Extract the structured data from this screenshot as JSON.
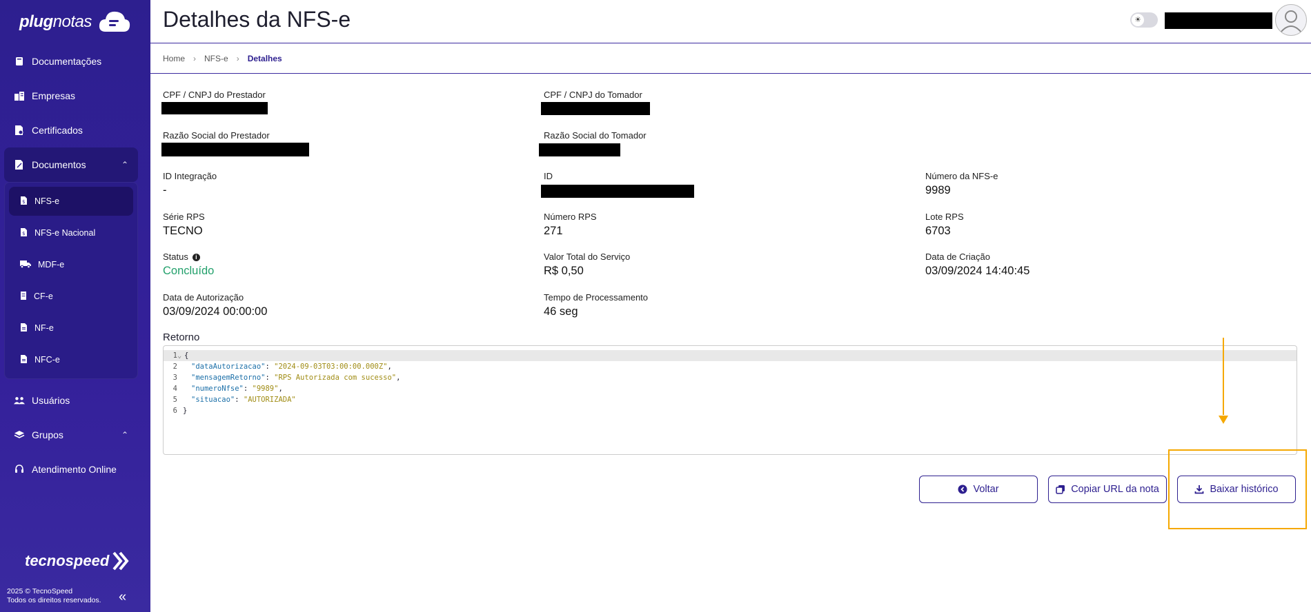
{
  "brand": {
    "name_bold": "plug",
    "name_light": "notas",
    "footer_brand": "tecnospeed"
  },
  "sidebar": {
    "items": [
      {
        "label": "Documentações",
        "icon": "book-icon"
      },
      {
        "label": "Empresas",
        "icon": "building-icon"
      },
      {
        "label": "Certificados",
        "icon": "certificate-icon"
      },
      {
        "label": "Documentos",
        "icon": "document-icon"
      }
    ],
    "sub_items": [
      {
        "label": "NFS-e",
        "icon": "file-icon",
        "active": true
      },
      {
        "label": "NFS-e Nacional",
        "icon": "file-icon"
      },
      {
        "label": "MDF-e",
        "icon": "truck-icon"
      },
      {
        "label": "CF-e",
        "icon": "receipt-icon"
      },
      {
        "label": "NF-e",
        "icon": "file-icon"
      },
      {
        "label": "NFC-e",
        "icon": "file-icon"
      }
    ],
    "items_after": [
      {
        "label": "Usuários",
        "icon": "users-icon"
      },
      {
        "label": "Grupos",
        "icon": "layers-icon"
      },
      {
        "label": "Atendimento Online",
        "icon": "headset-icon"
      }
    ],
    "copyright_line1": "2025 © TecnoSpeed",
    "copyright_line2": "Todos os direitos reservados."
  },
  "header": {
    "title": "Detalhes da NFS-e"
  },
  "breadcrumb": {
    "home": "Home",
    "section": "NFS-e",
    "current": "Detalhes"
  },
  "details": {
    "cpf_prestador_label": "CPF / CNPJ do Prestador",
    "cpf_tomador_label": "CPF / CNPJ do Tomador",
    "razao_prestador_label": "Razão Social do Prestador",
    "razao_tomador_label": "Razão Social do Tomador",
    "id_integracao_label": "ID Integração",
    "id_integracao_value": "-",
    "id_label": "ID",
    "numero_nfse_label": "Número da NFS-e",
    "numero_nfse_value": "9989",
    "serie_rps_label": "Série RPS",
    "serie_rps_value": "TECNO",
    "numero_rps_label": "Número RPS",
    "numero_rps_value": "271",
    "lote_rps_label": "Lote RPS",
    "lote_rps_value": "6703",
    "status_label": "Status",
    "status_value": "Concluído",
    "valor_label": "Valor Total do Serviço",
    "valor_value": "R$ 0,50",
    "data_criacao_label": "Data de Criação",
    "data_criacao_value": "03/09/2024 14:40:45",
    "data_autorizacao_label": "Data de Autorização",
    "data_autorizacao_value": "03/09/2024 00:00:00",
    "tempo_label": "Tempo de Processamento",
    "tempo_value": "46 seg"
  },
  "retorno": {
    "label": "Retorno",
    "lines": [
      {
        "n": "1",
        "text": "{"
      },
      {
        "n": "2",
        "key": "\"dataAutorizacao\"",
        "value": "\"2024-09-03T03:00:00.000Z\"",
        "trail": ","
      },
      {
        "n": "3",
        "key": "\"mensagemRetorno\"",
        "value": "\"RPS Autorizada com sucesso\"",
        "trail": ","
      },
      {
        "n": "4",
        "key": "\"numeroNfse\"",
        "value": "\"9989\"",
        "trail": ","
      },
      {
        "n": "5",
        "key": "\"situacao\"",
        "value": "\"AUTORIZADA\"",
        "trail": ""
      },
      {
        "n": "6",
        "text": "}"
      }
    ]
  },
  "actions": {
    "voltar": "Voltar",
    "copiar": "Copiar URL da nota",
    "baixar": "Baixar histórico"
  },
  "colors": {
    "sidebar": "#2d1f8f",
    "accent": "#2d1f8f",
    "success": "#22a06b",
    "annotation": "#f5a800"
  }
}
